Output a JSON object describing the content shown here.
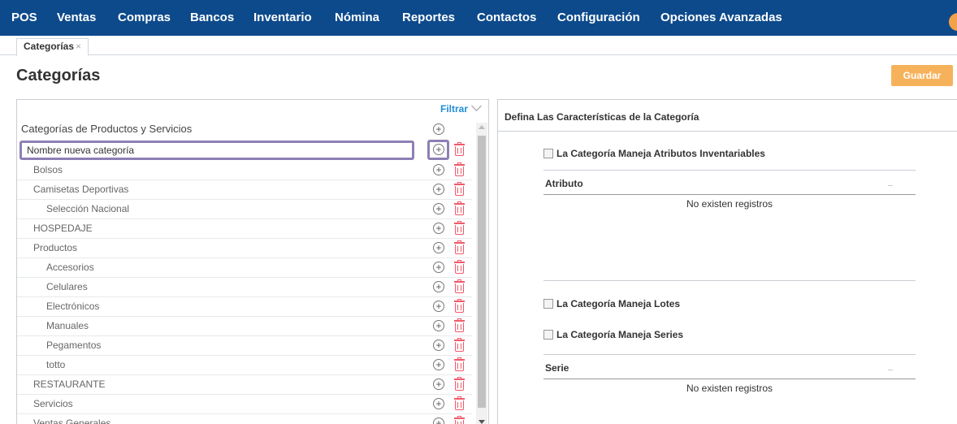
{
  "nav": {
    "items": [
      "POS",
      "Ventas",
      "Compras",
      "Bancos",
      "Inventario",
      "Nómina",
      "Reportes",
      "Contactos",
      "Configuración",
      "Opciones Avanzadas"
    ]
  },
  "tabs": [
    {
      "label": "Categorías",
      "close": "×"
    }
  ],
  "page": {
    "title": "Categorías",
    "save_label": "Guardar"
  },
  "tree": {
    "filter_label": "Filtrar",
    "header": "Categorías de Productos y Servicios",
    "new_placeholder": "Nombre nueva categoría",
    "new_value": "Nombre nueva categoría",
    "items": [
      {
        "label": "Bolsos",
        "level": 1
      },
      {
        "label": "Camisetas Deportivas",
        "level": 1
      },
      {
        "label": "Selección Nacional",
        "level": 2
      },
      {
        "label": "HOSPEDAJE",
        "level": 1
      },
      {
        "label": "Productos",
        "level": 1
      },
      {
        "label": "Accesorios",
        "level": 2
      },
      {
        "label": "Celulares",
        "level": 2
      },
      {
        "label": "Electrónicos",
        "level": 2
      },
      {
        "label": "Manuales",
        "level": 2
      },
      {
        "label": "Pegamentos",
        "level": 2
      },
      {
        "label": "totto",
        "level": 2
      },
      {
        "label": "RESTAURANTE",
        "level": 1
      },
      {
        "label": "Servicios",
        "level": 1
      },
      {
        "label": "Ventas Generales",
        "level": 1
      }
    ],
    "icons": {
      "add": "plus-circle-icon",
      "delete": "trash-icon"
    },
    "delete_color": "#f05a6a"
  },
  "details": {
    "title": "Defina Las Características de la Categoría",
    "attributes_checkbox": "La Categoría Maneja Atributos Inventariables",
    "attributes_header": "Atributo",
    "attributes_empty": "No existen registros",
    "lots_checkbox": "La Categoría Maneja Lotes",
    "series_checkbox": "La Categoría Maneja Series",
    "series_header": "Serie",
    "series_empty": "No existen registros"
  },
  "colors": {
    "navbar": "#0d4a8c",
    "accent": "#f6b25b",
    "link": "#1f8dd6",
    "highlight": "#8e7fb5"
  }
}
